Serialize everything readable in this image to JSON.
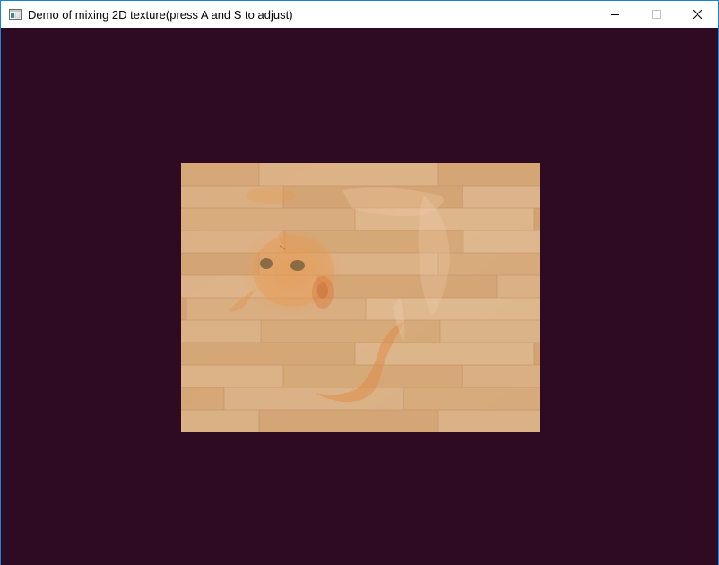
{
  "window": {
    "title": "Demo of mixing 2D texture(press A and S to adjust)"
  },
  "titlebar": {
    "icon": "app-window-icon",
    "buttons": {
      "minimize": "minimize-icon",
      "maximize": "maximize-icon",
      "close": "close-icon"
    }
  },
  "scene": {
    "clear_color": "#2e0b22",
    "quad": {
      "base_texture": "wooden-floor",
      "overlay_texture": "cat",
      "wood_light": "#dcb388",
      "wood_mid": "#cfa272",
      "wood_dark": "#b98a5c"
    }
  }
}
